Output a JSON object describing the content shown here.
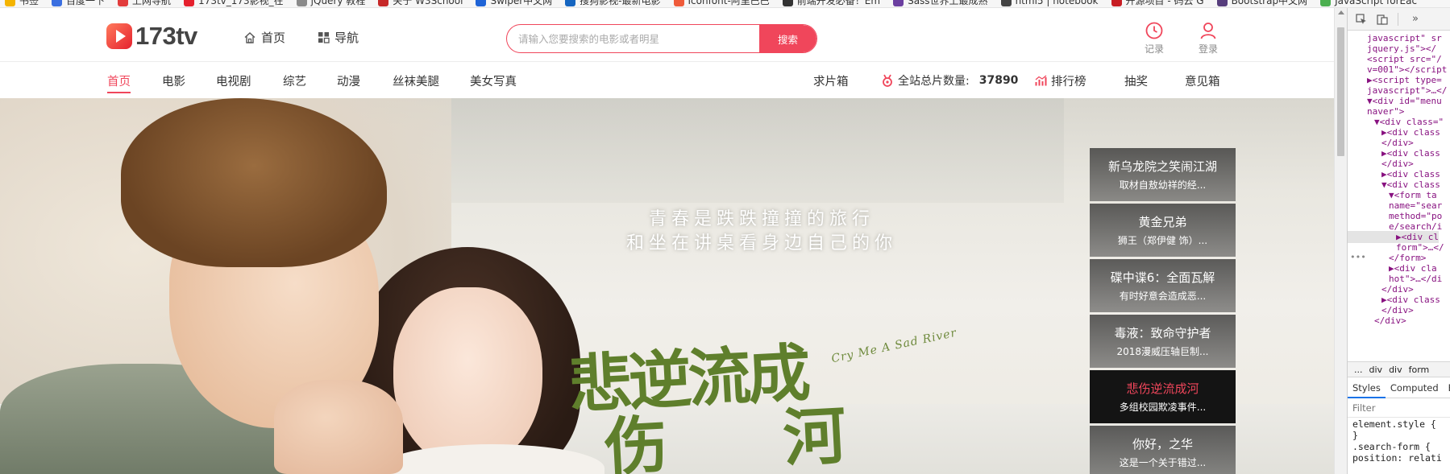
{
  "bookmarks": [
    {
      "label": "书签",
      "color": "#f4b400"
    },
    {
      "label": "百度一下",
      "color": "#3b6fe0"
    },
    {
      "label": "上网导航",
      "color": "#e23c3c"
    },
    {
      "label": "173tv_173影视_在",
      "color": "#e5212e"
    },
    {
      "label": "jQuery 教程",
      "color": "#8a8a8a"
    },
    {
      "label": "关于 W3School",
      "color": "#c62828"
    },
    {
      "label": "Swiper中文网",
      "color": "#1e63d6"
    },
    {
      "label": "搜狗影视-最新电影",
      "color": "#1565c0"
    },
    {
      "label": "Iconfont-阿里巴巴",
      "color": "#ef5b3a"
    },
    {
      "label": "前端开发必备！Em",
      "color": "#333333"
    },
    {
      "label": "Sass世界上最成熟",
      "color": "#6b3fa0"
    },
    {
      "label": "html5 | notebook",
      "color": "#444444"
    },
    {
      "label": "开源项目 - 码云 G",
      "color": "#c71d23"
    },
    {
      "label": "Bootstrap中文网",
      "color": "#563d7c"
    },
    {
      "label": "JavaScript forEac",
      "color": "#4caf50"
    }
  ],
  "header": {
    "logo_text": "173tv",
    "nav_home": "首页",
    "nav_guide": "导航",
    "search_placeholder": "请输入您要搜索的电影或者明星",
    "search_button": "搜索",
    "record_label": "记录",
    "login_label": "登录",
    "accent": "#f0465b"
  },
  "subnav": {
    "items": [
      "首页",
      "电影",
      "电视剧",
      "综艺",
      "动漫",
      "丝袜美腿",
      "美女写真"
    ],
    "active_index": 0,
    "request": "求片箱",
    "stat_label": "全站总片数量:",
    "stat_value": "37890",
    "ranking": "排行榜",
    "lottery": "抽奖",
    "feedback": "意见箱"
  },
  "hero": {
    "slogan_line1": "青春是跌跌撞撞的旅行",
    "slogan_line2": "和坐在讲桌看身边自己的你",
    "title_line1": "悲逆流成",
    "title_line2": "伤　　河",
    "title_en": "Cry Me A Sad River",
    "playlist": [
      {
        "title": "新乌龙院之笑闹江湖",
        "sub": "取材自敖幼祥的经..."
      },
      {
        "title": "黄金兄弟",
        "sub": "狮王（郑伊健 饰）..."
      },
      {
        "title": "碟中谍6：全面瓦解",
        "sub": "有时好意会造成恶..."
      },
      {
        "title": "毒液：致命守护者",
        "sub": "2018漫威压轴巨制..."
      },
      {
        "title": "悲伤逆流成河",
        "sub": "多组校园欺凌事件..."
      },
      {
        "title": "你好，之华",
        "sub": "这是一个关于错过..."
      }
    ],
    "playlist_active": 4
  },
  "devtools": {
    "code_lines": [
      {
        "indent": 0,
        "html": "javascript\" sr"
      },
      {
        "indent": 0,
        "html": "jquery.js\"></"
      },
      {
        "indent": 0,
        "html": "<script src=\"/"
      },
      {
        "indent": 0,
        "html": "v=001\"></script"
      },
      {
        "indent": 0,
        "html": "▶<script type="
      },
      {
        "indent": 0,
        "html": "javascript\">…</"
      },
      {
        "indent": 0,
        "html": "▼<div id=\"menu"
      },
      {
        "indent": 0,
        "html": "naver\">"
      },
      {
        "indent": 1,
        "html": "▼<div class=\""
      },
      {
        "indent": 2,
        "html": "▶<div class"
      },
      {
        "indent": 2,
        "html": "</div>"
      },
      {
        "indent": 2,
        "html": "▶<div class"
      },
      {
        "indent": 2,
        "html": "</div>"
      },
      {
        "indent": 2,
        "html": "▶<div class"
      },
      {
        "indent": 2,
        "html": "▼<div class"
      },
      {
        "indent": 3,
        "html": "▼<form ta"
      },
      {
        "indent": 3,
        "html": "name=\"sear"
      },
      {
        "indent": 3,
        "html": "method=\"po"
      },
      {
        "indent": 3,
        "html": "e/search/i"
      },
      {
        "indent": 4,
        "html": "▶<div cl"
      },
      {
        "indent": 4,
        "html": "form\">…</"
      },
      {
        "indent": 3,
        "html": "</form>"
      },
      {
        "indent": 3,
        "html": "▶<div cla"
      },
      {
        "indent": 3,
        "html": "hot\">…</di"
      },
      {
        "indent": 2,
        "html": "</div>"
      },
      {
        "indent": 2,
        "html": "▶<div class"
      },
      {
        "indent": 2,
        "html": "</div>"
      },
      {
        "indent": 1,
        "html": "</div>"
      }
    ],
    "selected_line": 19,
    "breadcrumbs": [
      "...",
      "div",
      "div",
      "form"
    ],
    "tabs": [
      "Styles",
      "Computed",
      "Ev"
    ],
    "filter": "Filter",
    "styles": [
      "element.style {",
      "}",
      ".search-form {",
      "  position: relati"
    ]
  }
}
